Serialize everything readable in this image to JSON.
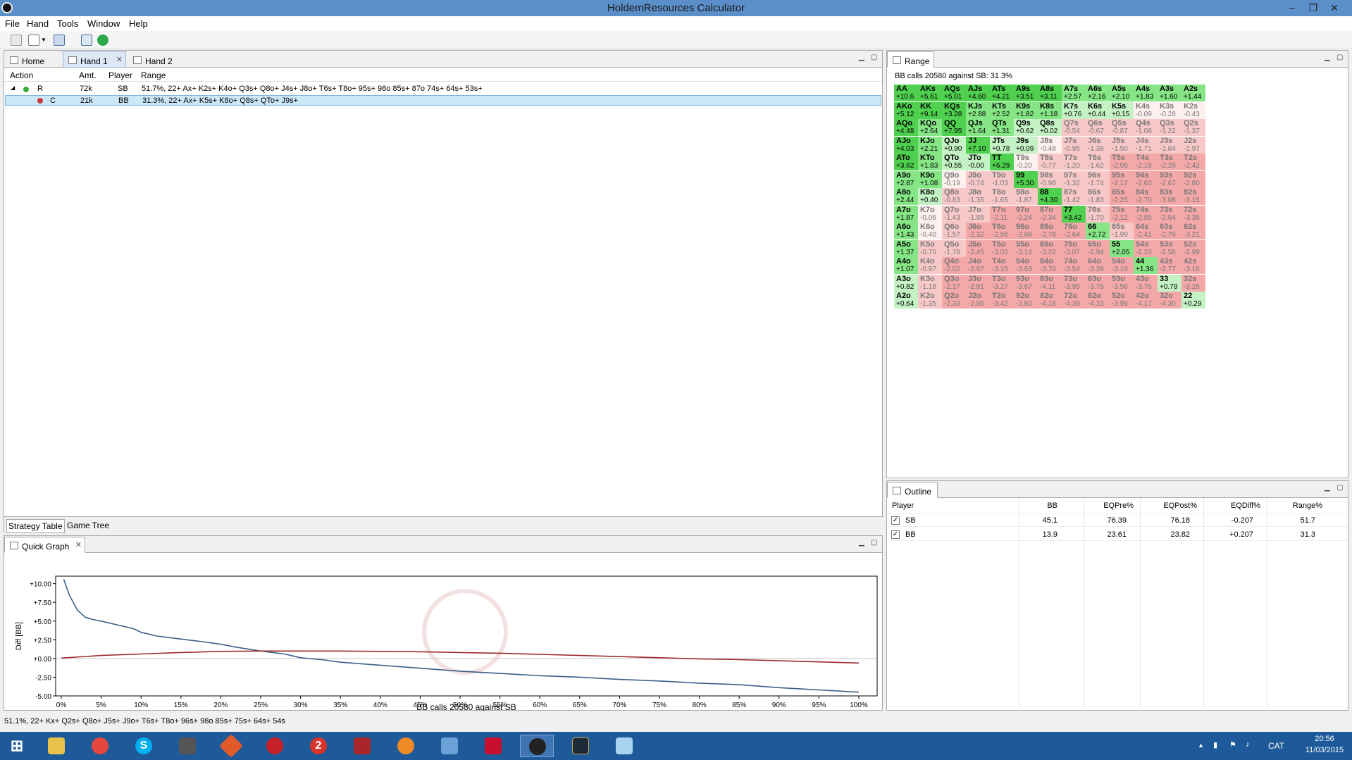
{
  "window": {
    "title": "HoldemResources Calculator",
    "min": "–",
    "max": "❐",
    "close": "✕"
  },
  "menu": [
    "File",
    "Hand",
    "Tools",
    "Window",
    "Help"
  ],
  "tabs": {
    "home": "Home",
    "hand1": "Hand 1",
    "hand2": "Hand 2"
  },
  "strategy": {
    "headers": {
      "action": "Action",
      "amt": "Amt.",
      "player": "Player",
      "range": "Range"
    },
    "rows": [
      {
        "action": "R",
        "amt": "72k",
        "player": "SB",
        "range": "51.7%, 22+ Ax+ K2s+ K4o+ Q3s+ Q8o+ J4s+ J8o+ T6s+ T8o+ 95s+ 98o 85s+ 87o 74s+ 64s+ 53s+"
      },
      {
        "action": "C",
        "amt": "21k",
        "player": "BB",
        "range": "31.3%, 22+ Ax+ K5s+ K8o+ Q8s+ QTo+ J9s+"
      }
    ],
    "bottom_tabs": [
      "Strategy Table",
      "Game Tree"
    ]
  },
  "quickgraph": {
    "tab": "Quick Graph"
  },
  "chart_data": {
    "type": "line",
    "xlabel": "BB calls 20580 against SB",
    "ylabel": "Diff [BB]",
    "xlim": [
      0,
      100
    ],
    "ylim": [
      -5,
      11
    ],
    "xticks": [
      "0%",
      "5%",
      "10%",
      "15%",
      "20%",
      "25%",
      "30%",
      "35%",
      "40%",
      "45%",
      "50%",
      "55%",
      "60%",
      "65%",
      "70%",
      "75%",
      "80%",
      "85%",
      "90%",
      "95%",
      "100%"
    ],
    "yticks": [
      "+10.00",
      "+7.50",
      "+5.00",
      "+2.50",
      "+0.00",
      "-2.50",
      "-5.00"
    ],
    "ytick_values": [
      10,
      7.5,
      5,
      2.5,
      0,
      -2.5,
      -5
    ],
    "series": [
      {
        "color": "#3a5f87",
        "x": [
          0.3,
          1,
          2,
          3,
          4,
          5,
          7,
          9,
          10,
          12,
          15,
          18,
          20,
          22,
          25,
          28,
          30,
          33,
          35,
          40,
          45,
          50,
          55,
          60,
          65,
          70,
          75,
          80,
          85,
          90,
          95,
          100
        ],
        "y": [
          10.6,
          8.5,
          6.5,
          5.5,
          5.2,
          5.0,
          4.5,
          4.0,
          3.5,
          3.0,
          2.6,
          2.2,
          1.9,
          1.5,
          1.0,
          0.6,
          0.1,
          -0.2,
          -0.5,
          -0.9,
          -1.3,
          -1.7,
          -2.0,
          -2.3,
          -2.5,
          -2.8,
          -3.0,
          -3.3,
          -3.5,
          -3.9,
          -4.2,
          -4.5
        ]
      },
      {
        "color": "#9e2a2a",
        "x": [
          0,
          5,
          10,
          15,
          20,
          25,
          30,
          35,
          40,
          45,
          50,
          55,
          60,
          65,
          70,
          75,
          80,
          85,
          90,
          95,
          100
        ],
        "y": [
          0.05,
          0.4,
          0.6,
          0.8,
          0.95,
          1.0,
          1.0,
          1.0,
          0.95,
          0.9,
          0.8,
          0.7,
          0.55,
          0.4,
          0.25,
          0.1,
          -0.05,
          -0.15,
          -0.3,
          -0.45,
          -0.6
        ]
      }
    ]
  },
  "range": {
    "tab": "Range",
    "caption": "BB calls 20580 against SB: 31.3%",
    "colors": {
      "strong": "#4fd14f",
      "mid": "#86e686",
      "light": "#c4f2c4",
      "neutral": "#fff0f0",
      "weak": "#f8c8c8",
      "neg": "#f4a8a8"
    },
    "hands": [
      [
        "AA",
        "AKs",
        "AQs",
        "AJs",
        "ATs",
        "A9s",
        "A8s",
        "A7s",
        "A6s",
        "A5s",
        "A4s",
        "A3s",
        "A2s"
      ],
      [
        "AKo",
        "KK",
        "KQs",
        "KJs",
        "KTs",
        "K9s",
        "K8s",
        "K7s",
        "K6s",
        "K5s",
        "K4s",
        "K3s",
        "K2s"
      ],
      [
        "AQo",
        "KQo",
        "QQ",
        "QJs",
        "QTs",
        "Q9s",
        "Q8s",
        "Q7s",
        "Q6s",
        "Q5s",
        "Q4s",
        "Q3s",
        "Q2s"
      ],
      [
        "AJo",
        "KJo",
        "QJo",
        "JJ",
        "JTs",
        "J9s",
        "J8s",
        "J7s",
        "J6s",
        "J5s",
        "J4s",
        "J3s",
        "J2s"
      ],
      [
        "ATo",
        "KTo",
        "QTo",
        "JTo",
        "TT",
        "T9s",
        "T8s",
        "T7s",
        "T6s",
        "T5s",
        "T4s",
        "T3s",
        "T2s"
      ],
      [
        "A9o",
        "K9o",
        "Q9o",
        "J9o",
        "T9o",
        "99",
        "98s",
        "97s",
        "96s",
        "95s",
        "94s",
        "93s",
        "92s"
      ],
      [
        "A8o",
        "K8o",
        "Q8o",
        "J8o",
        "T8o",
        "98o",
        "88",
        "87s",
        "86s",
        "85s",
        "84s",
        "83s",
        "82s"
      ],
      [
        "A7o",
        "K7o",
        "Q7o",
        "J7o",
        "T7o",
        "97o",
        "87o",
        "77",
        "76s",
        "75s",
        "74s",
        "73s",
        "72s"
      ],
      [
        "A6o",
        "K6o",
        "Q6o",
        "J6o",
        "T6o",
        "96o",
        "86o",
        "76o",
        "66",
        "65s",
        "64s",
        "63s",
        "62s"
      ],
      [
        "A5o",
        "K5o",
        "Q5o",
        "J5o",
        "T5o",
        "95o",
        "85o",
        "75o",
        "65o",
        "55",
        "54s",
        "53s",
        "52s"
      ],
      [
        "A4o",
        "K4o",
        "Q4o",
        "J4o",
        "T4o",
        "94o",
        "84o",
        "74o",
        "64o",
        "54o",
        "44",
        "43s",
        "42s"
      ],
      [
        "A3o",
        "K3o",
        "Q3o",
        "J3o",
        "T3o",
        "93o",
        "83o",
        "73o",
        "63o",
        "53o",
        "43o",
        "33",
        "32s"
      ],
      [
        "A2o",
        "K2o",
        "Q2o",
        "J2o",
        "T2o",
        "92o",
        "82o",
        "72o",
        "62o",
        "52o",
        "42o",
        "32o",
        "22"
      ]
    ],
    "values": [
      [
        "+10.6",
        "+5.61",
        "+5.01",
        "+4.60",
        "+4.21",
        "+3.51",
        "+3.11",
        "+2.57",
        "+2.16",
        "+2.10",
        "+1.83",
        "+1.60",
        "+1.44"
      ],
      [
        "+5.12",
        "+9.14",
        "+3.28",
        "+2.88",
        "+2.52",
        "+1.82",
        "+1.18",
        "+0.76",
        "+0.44",
        "+0.15",
        "-0.09",
        "-0.28",
        "-0.43"
      ],
      [
        "+4.48",
        "+2.64",
        "+7.95",
        "+1.64",
        "+1.31",
        "+0.62",
        "+0.02",
        "-0.54",
        "-0.67",
        "-0.87",
        "-1.08",
        "-1.22",
        "-1.37"
      ],
      [
        "+4.03",
        "+2.21",
        "+0.90",
        "+7.10",
        "+0.78",
        "+0.09",
        "-0.48",
        "-0.95",
        "-1.38",
        "-1.50",
        "-1.71",
        "-1.84",
        "-1.97"
      ],
      [
        "+3.62",
        "+1.83",
        "+0.55",
        "-0.00",
        "+6.29",
        "-0.20",
        "-0.77",
        "-1.20",
        "-1.62",
        "-2.05",
        "-2.18",
        "-2.29",
        "-2.42"
      ],
      [
        "+2.87",
        "+1.08",
        "-0.19",
        "-0.74",
        "-1.03",
        "+5.30",
        "-0.98",
        "-1.32",
        "-1.74",
        "-2.17",
        "-2.63",
        "-2.67",
        "-2.80"
      ],
      [
        "+2.44",
        "+0.40",
        "-0.83",
        "-1.35",
        "-1.65",
        "-1.87",
        "+4.30",
        "-1.42",
        "-1.83",
        "-2.25",
        "-2.70",
        "-3.08",
        "-3.15"
      ],
      [
        "+1.87",
        "-0.06",
        "-1.43",
        "-1.85",
        "-2.11",
        "-2.24",
        "-2.34",
        "+3.42",
        "-1.70",
        "-2.12",
        "-2.55",
        "-2.94",
        "-3.35"
      ],
      [
        "+1.43",
        "-0.40",
        "-1.57",
        "-2.32",
        "-2.56",
        "-2.68",
        "-2.78",
        "-2.64",
        "+2.72",
        "-1.99",
        "-2.41",
        "-2.79",
        "-3.21"
      ],
      [
        "+1.37",
        "-0.70",
        "-1.78",
        "-2.45",
        "-3.02",
        "-3.14",
        "-3.22",
        "-3.07",
        "-2.94",
        "+2.05",
        "-2.23",
        "-2.58",
        "-2.99"
      ],
      [
        "+1.07",
        "-0.97",
        "-2.02",
        "-2.67",
        "-3.15",
        "-3.63",
        "-3.70",
        "-3.54",
        "-3.39",
        "-3.18",
        "+1.36",
        "-2.77",
        "-3.16"
      ],
      [
        "+0.82",
        "-1.18",
        "-2.17",
        "-2.81",
        "-3.27",
        "-3.67",
        "-4.11",
        "-3.95",
        "-3.78",
        "-3.56",
        "-3.76",
        "+0.79",
        "-3.28"
      ],
      [
        "+0.64",
        "-1.35",
        "-2.33",
        "-2.95",
        "-3.42",
        "-3.82",
        "-4.18",
        "-4.39",
        "-4.23",
        "-3.99",
        "-4.17",
        "-4.30",
        "+0.29"
      ]
    ]
  },
  "outline": {
    "tab": "Outline",
    "headers": [
      "Player",
      "BB",
      "EQPre%",
      "EQPost%",
      "EQDiff%",
      "Range%"
    ],
    "rows": [
      {
        "check": "✓",
        "player": "SB",
        "bb": "45.1",
        "pre": "76.39",
        "post": "76.18",
        "diff": "-0.207",
        "range": "51.7"
      },
      {
        "check": "✓",
        "player": "BB",
        "bb": "13.9",
        "pre": "23.61",
        "post": "23.82",
        "diff": "+0.207",
        "range": "31.3"
      }
    ]
  },
  "status": "51.1%, 22+ Kx+ Q2s+ Q8o+ J5s+ J9o+ T6s+ T8o+ 96s+ 98o 85s+ 75s+ 64s+ 54s",
  "taskbar": {
    "lang": "CAT",
    "time": "20:56",
    "date": "11/03/2015",
    "icons": [
      "S",
      "2"
    ]
  }
}
